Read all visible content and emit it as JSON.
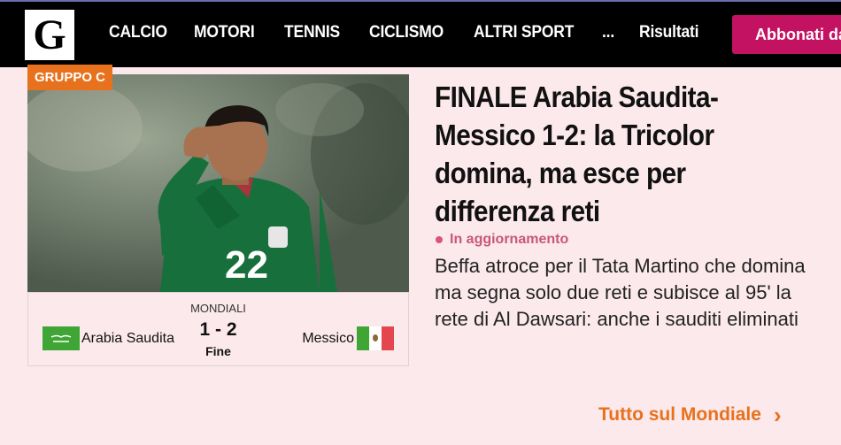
{
  "navbar": {
    "logo": "G",
    "items": [
      {
        "label": "CALCIO"
      },
      {
        "label": "MOTORI"
      },
      {
        "label": "TENNIS"
      },
      {
        "label": "CICLISMO"
      },
      {
        "label": "ALTRI SPORT"
      },
      {
        "label": "..."
      },
      {
        "label": "Risultati"
      }
    ],
    "subscribe_label": "Abbonati da"
  },
  "article": {
    "badge": "GRUPPO C",
    "headline": "FINALE Arabia Saudita-Messico 1-2: la Tricolor domina, ma esce per differenza reti",
    "live_label": "In aggiornamento",
    "summary": "Beffa atroce per il Tata Martino che domina ma segna solo due reti e subisce al 95' la rete di Al Dawsari: anche i sauditi eliminati",
    "more_link": "Tutto sul Mondiale",
    "more_icon": "chevron-right-icon"
  },
  "match": {
    "competition": "MONDIALI",
    "home_team": "Arabia Saudita",
    "away_team": "Messico",
    "score": "1 - 2",
    "status": "Fine",
    "home_flag": "saudi-arabia-flag",
    "away_flag": "mexico-flag"
  },
  "colors": {
    "background": "#fbe9ec",
    "navbar": "#000000",
    "accent_orange": "#e8711d",
    "subscribe": "#c41262",
    "live": "#c85878"
  }
}
